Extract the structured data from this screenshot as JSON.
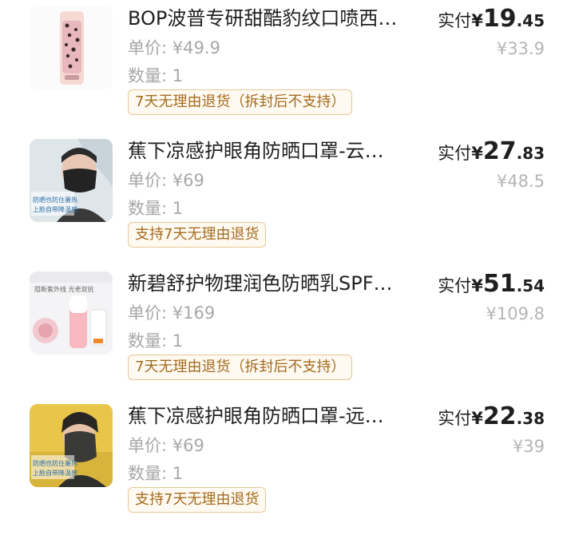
{
  "items": [
    {
      "title": "BOP波普专研甜酷豹纹口喷西…",
      "unit_price": "单价: ¥49.9",
      "quantity": "数量: 1",
      "policy": "7天无理由退货（拆封后不支持）",
      "paid_label": "实付",
      "paid_currency": "¥",
      "paid_int": "19",
      "paid_dec": ".45",
      "original_price": "¥33.9"
    },
    {
      "title": "蕉下凉感护眼角防晒口罩-云…",
      "unit_price": "单价: ¥69",
      "quantity": "数量: 1",
      "policy": "支持7天无理由退货",
      "paid_label": "实付",
      "paid_currency": "¥",
      "paid_int": "27",
      "paid_dec": ".83",
      "original_price": "¥48.5",
      "thumb_text": [
        "防晒也防住暑热",
        "上脸自带降温感"
      ]
    },
    {
      "title": "新碧舒护物理润色防晒乳SPF…",
      "unit_price": "单价: ¥169",
      "quantity": "数量: 1",
      "policy": "7天无理由退货（拆封后不支持）",
      "paid_label": "实付",
      "paid_currency": "¥",
      "paid_int": "51",
      "paid_dec": ".54",
      "original_price": "¥109.8",
      "thumb_text": [
        "阻断紫外线 光老双抗"
      ]
    },
    {
      "title": "蕉下凉感护眼角防晒口罩-远…",
      "unit_price": "单价: ¥69",
      "quantity": "数量: 1",
      "policy": "支持7天无理由退货",
      "paid_label": "实付",
      "paid_currency": "¥",
      "paid_int": "22",
      "paid_dec": ".38",
      "original_price": "¥39",
      "thumb_text": [
        "防晒也防住暑热",
        "上脸自带降温感"
      ]
    }
  ],
  "colors": {
    "policy_border": "#e6c796",
    "policy_text": "#a46b1f",
    "muted_text": "#a8a8a8"
  }
}
